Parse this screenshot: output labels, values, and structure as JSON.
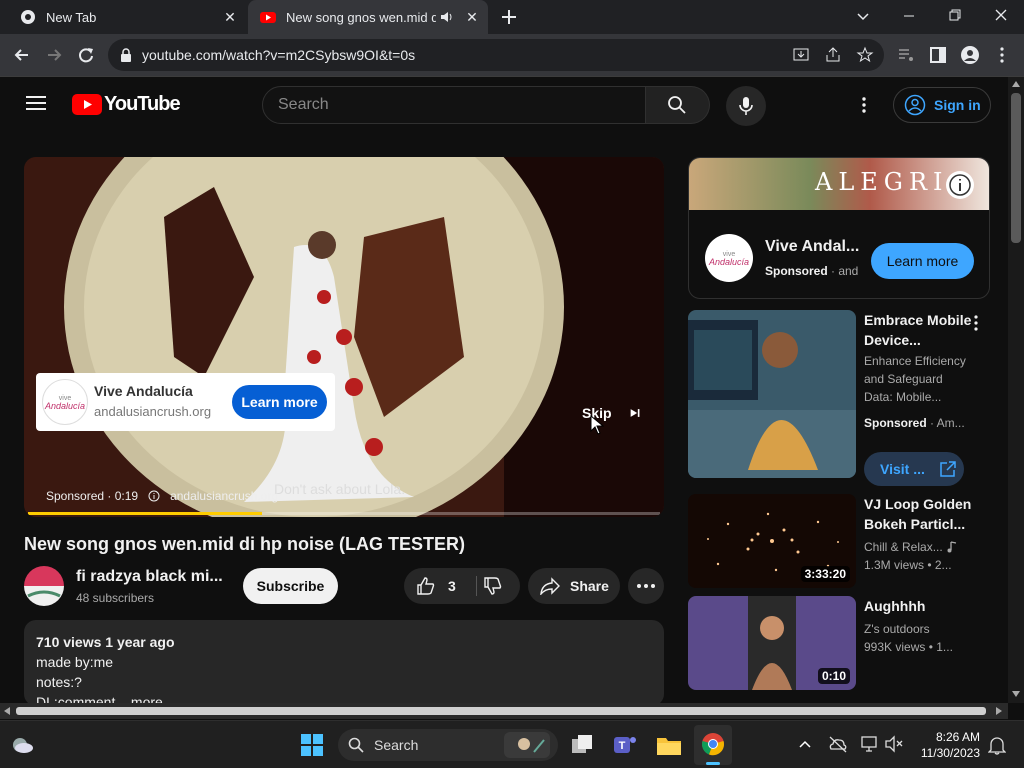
{
  "tabs": [
    {
      "title": "New Tab"
    },
    {
      "title": "New song gnos wen.mid di"
    }
  ],
  "address": {
    "url": "youtube.com/watch?v=m2CSybsw9OI&t=0s"
  },
  "masthead": {
    "logo_text": "YouTube",
    "search_placeholder": "Search",
    "signin_label": "Sign in"
  },
  "player": {
    "ad_card": {
      "name": "Vive Andalucía",
      "url": "andalusiancrush.org",
      "button": "Learn more"
    },
    "skip_label": "Skip",
    "subtitle": "Don't ask about Lola.",
    "ad_info": {
      "sponsored": "Sponsored · 0:19",
      "domain": "andalusiancrush.org"
    },
    "progress": 0.37
  },
  "video": {
    "title": "New song gnos wen.mid di hp noise (LAG TESTER)",
    "channel": "fi radzya black mi...",
    "subscribers": "48 subscribers",
    "subscribe_label": "Subscribe",
    "likes": "3",
    "share_label": "Share",
    "description": {
      "stats": "710 views  1 year ago",
      "line1": "made by:me",
      "line2": "notes:?",
      "line3": "DL:comment ...more"
    }
  },
  "side_ad": {
    "banner_text": "ALEGRIA",
    "title": "Vive Andal...",
    "sponsored": "Sponsored",
    "extra": " · and",
    "button": "Learn more"
  },
  "recommendations": [
    {
      "title": "Embrace Mobile Device...",
      "line1": "Enhance Efficiency",
      "line2": "and Safeguard",
      "line3": "Data: Mobile...",
      "sponsored": "Sponsored",
      "meta": " · Am...",
      "visit": "Visit ..."
    },
    {
      "title": "VJ Loop Golden Bokeh Particl...",
      "channel": "Chill & Relax...",
      "meta": "1.3M views  • 2...",
      "duration": "3:33:20"
    },
    {
      "title": "Aughhhh",
      "channel": "Z's outdoors",
      "meta": "993K views  • 1...",
      "duration": "0:10"
    }
  ],
  "taskbar": {
    "search_label": "Search",
    "time": "8:26 AM",
    "date": "11/30/2023"
  },
  "colors": {
    "bg": "#0f0f0f",
    "youtube_red": "#ff0000",
    "link_blue": "#3ea6ff",
    "ad_yellow": "#ffcc00"
  }
}
